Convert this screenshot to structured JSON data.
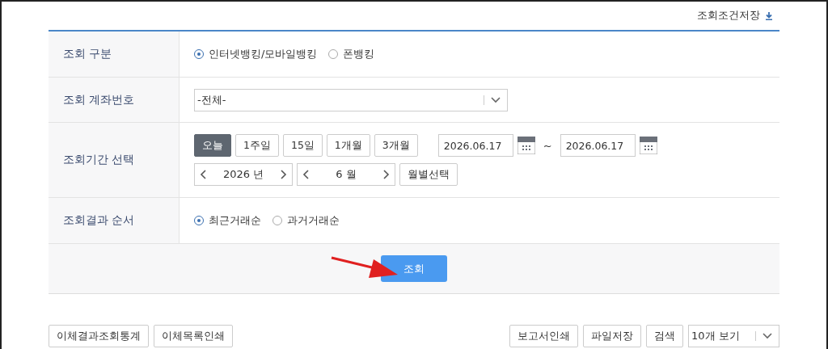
{
  "save_conditions": {
    "label": "조회조건저장"
  },
  "rows": [
    {
      "kind": "radio",
      "label": "조회 구분",
      "options": [
        {
          "label": "인터넷뱅킹/모바일뱅킹",
          "selected": true
        },
        {
          "label": "폰뱅킹",
          "selected": false
        }
      ]
    },
    {
      "kind": "select",
      "label": "조회 계좌번호",
      "value": "-전체-"
    },
    {
      "kind": "period",
      "label": "조회기간 선택",
      "presets": [
        {
          "label": "오늘",
          "selected": true
        },
        {
          "label": "1주일",
          "selected": false
        },
        {
          "label": "15일",
          "selected": false
        },
        {
          "label": "1개월",
          "selected": false
        },
        {
          "label": "3개월",
          "selected": false
        }
      ],
      "start_date": "2026.06.17",
      "separator": "~",
      "end_date": "2026.06.17",
      "year": "2026 년",
      "month": "6 월",
      "month_button": "월별선택"
    },
    {
      "kind": "radio",
      "label": "조회결과 순서",
      "options": [
        {
          "label": "최근거래순",
          "selected": true
        },
        {
          "label": "과거거래순",
          "selected": false
        }
      ]
    }
  ],
  "search_button": "조회",
  "left_buttons": [
    "이체결과조회통계",
    "이체목록인쇄"
  ],
  "right_buttons": [
    "보고서인쇄",
    "파일저장",
    "검색"
  ],
  "page_size": "10개 보기"
}
